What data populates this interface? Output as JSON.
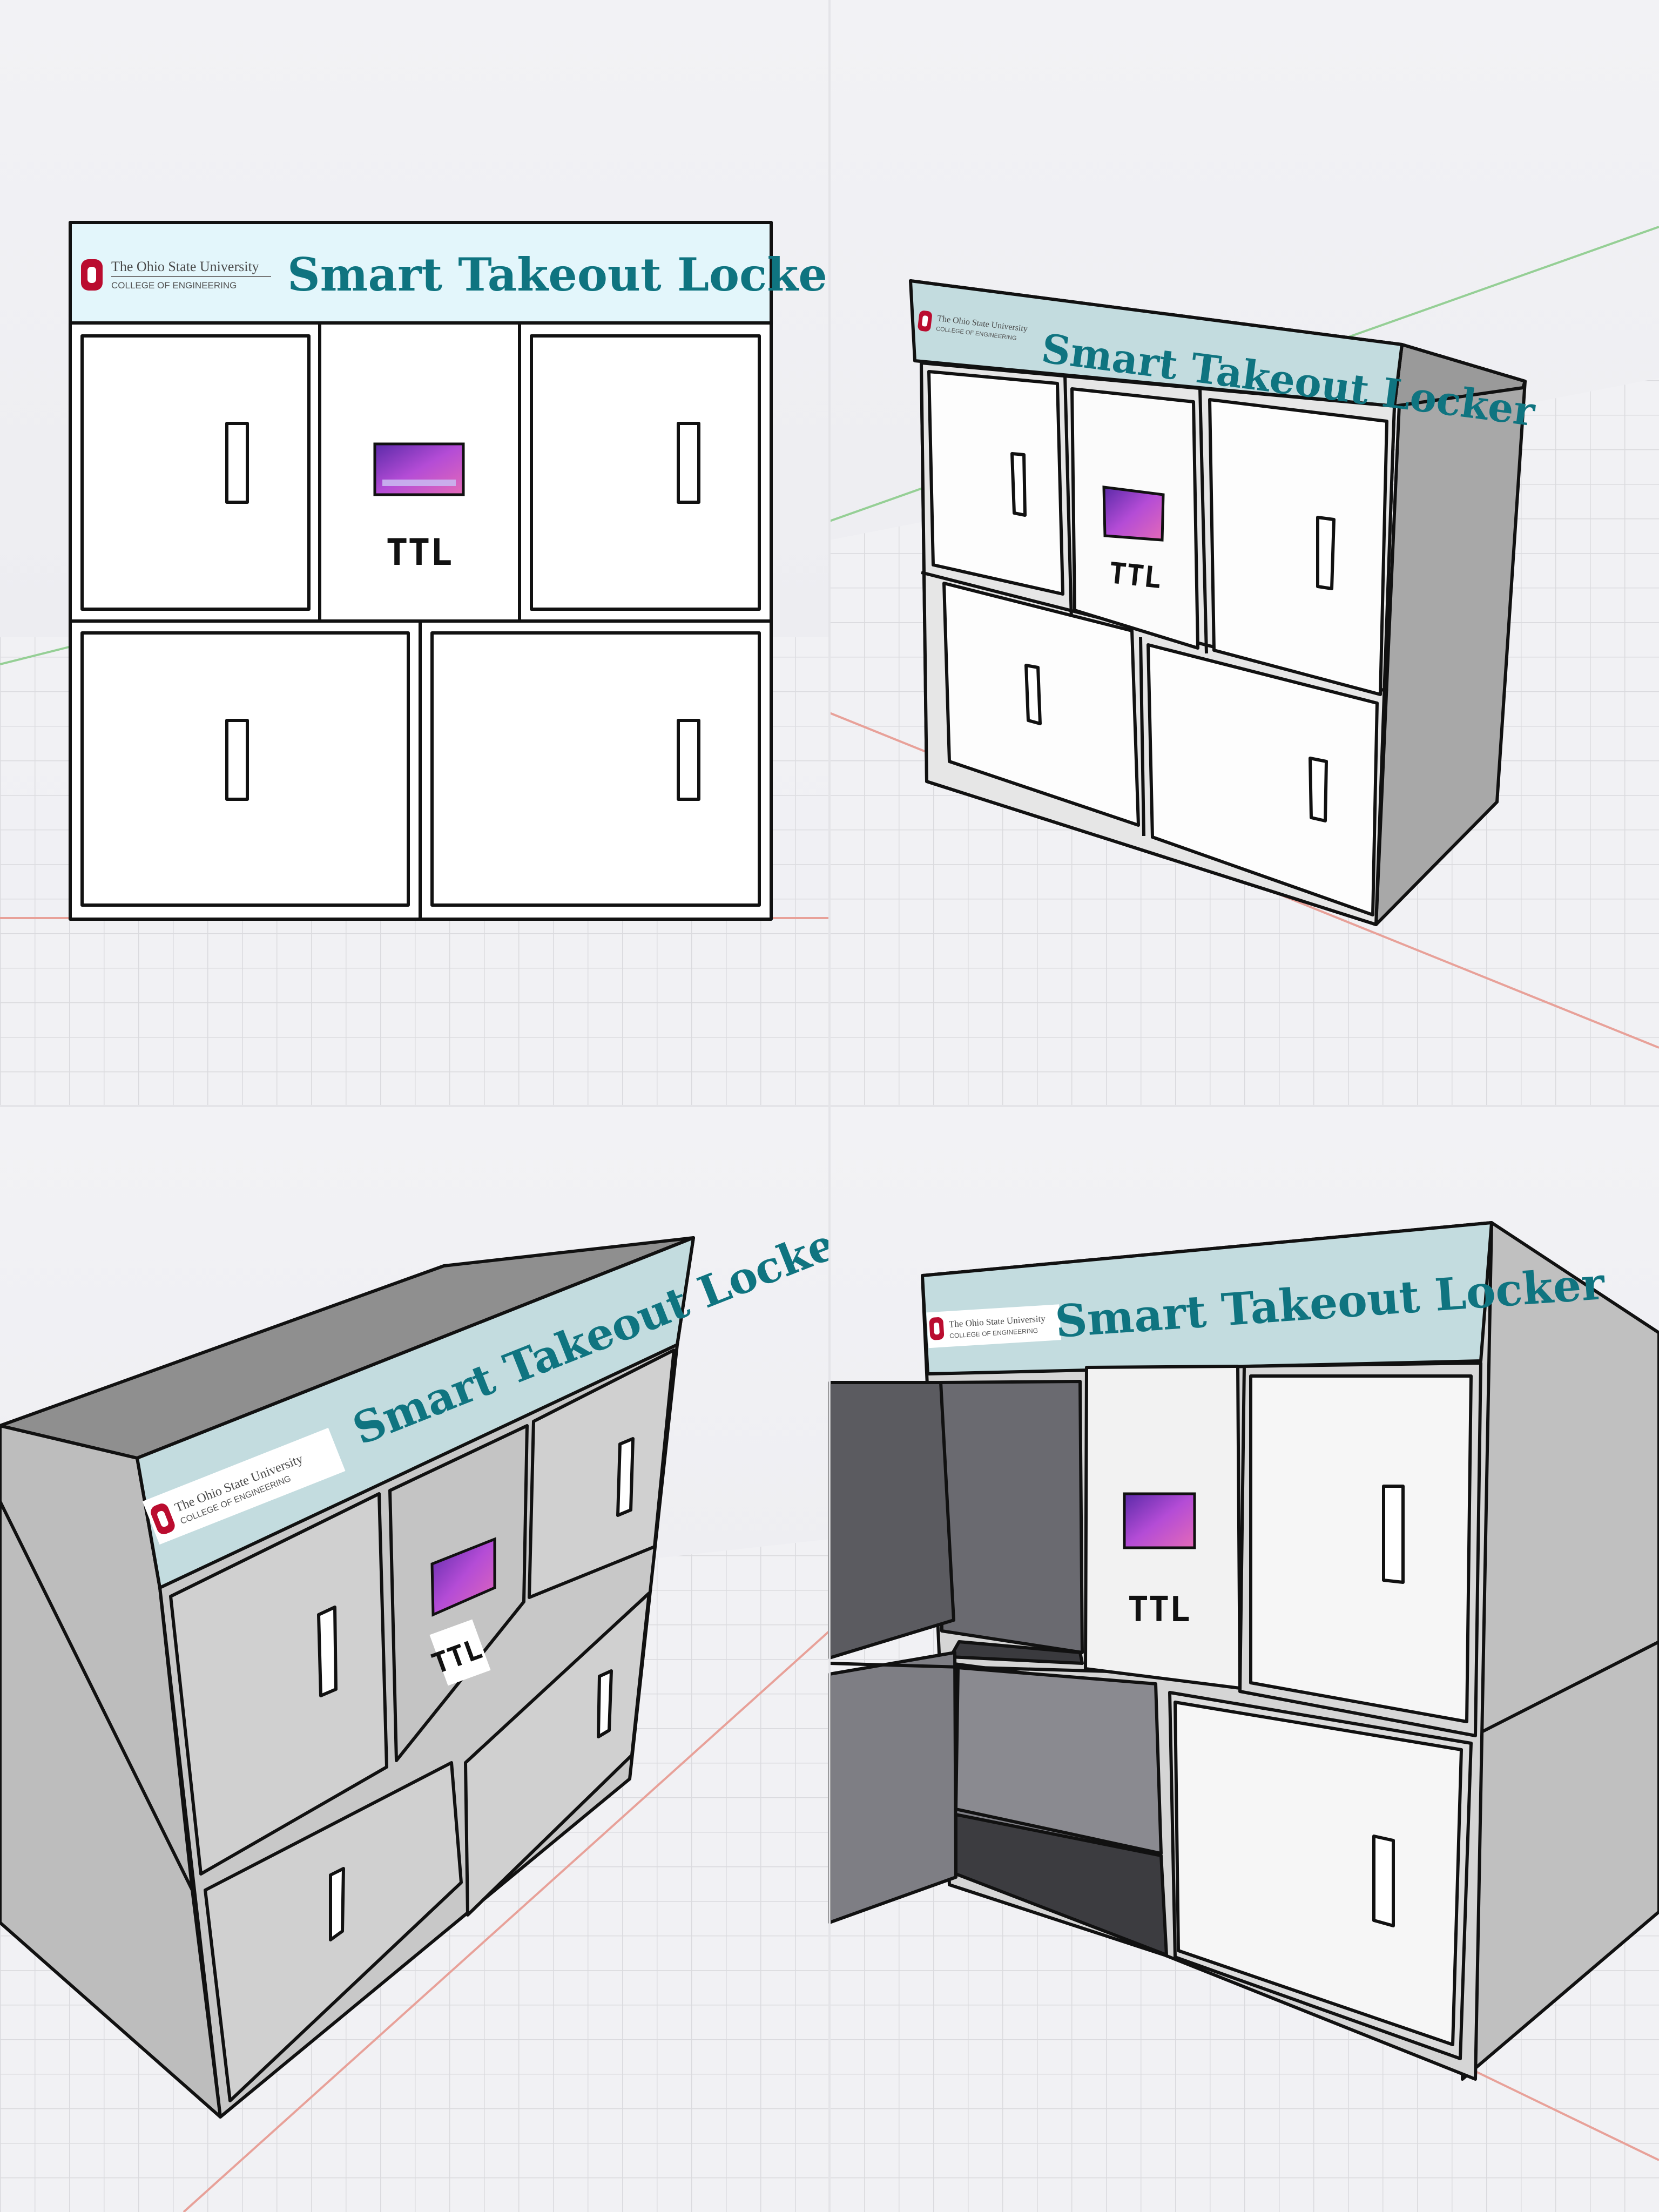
{
  "sign": {
    "title": "Smart Takeout Locker",
    "university": "The Ohio State University",
    "college": "COLLEGE OF ENGINEERING"
  },
  "logo": {
    "block_o_color": "#ba0c2f",
    "icon": "block-o-icon",
    "brand_mark": "TTL"
  },
  "colors": {
    "title": "#0f7480",
    "banner_front": "#e3f6fb",
    "banner_angled": "#c3dcdf",
    "floor": "#eeeef1",
    "grid": "#d9d9de",
    "axis_red": "#e58a80",
    "axis_green": "#8fd08f",
    "screen": "#9b3fd0"
  },
  "views": [
    {
      "name": "front-view"
    },
    {
      "name": "right-perspective-view"
    },
    {
      "name": "left-low-perspective-view"
    },
    {
      "name": "open-doors-view"
    }
  ]
}
